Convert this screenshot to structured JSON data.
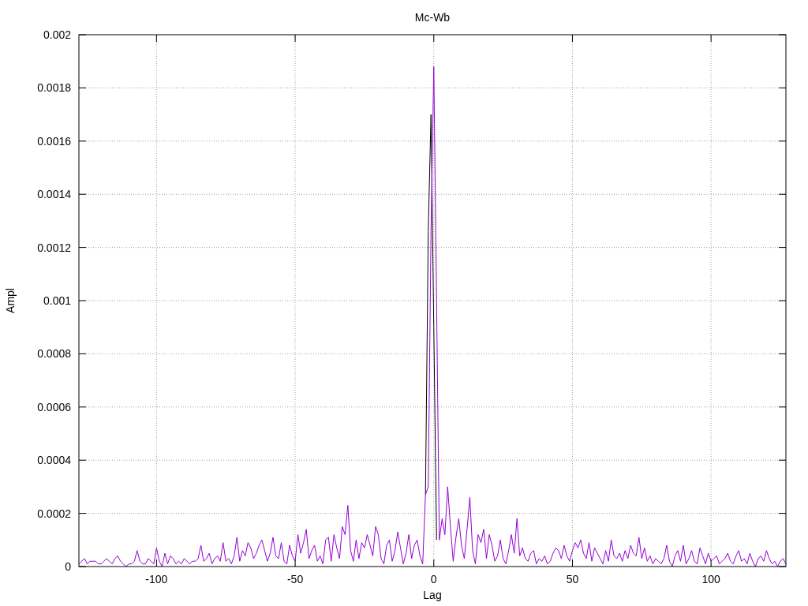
{
  "chart": {
    "chart_data": {
      "type": "line",
      "title": "Mc-Wb",
      "xlabel": "Lag",
      "ylabel": "Ampl",
      "xlim": [
        -128,
        127
      ],
      "ylim": [
        0,
        0.002
      ],
      "grid": true,
      "xticks": [
        -100,
        -50,
        0,
        50,
        100
      ],
      "yticks": [
        0,
        0.0002,
        0.0004,
        0.0006,
        0.0008,
        0.001,
        0.0012,
        0.0014,
        0.0016,
        0.0018,
        0.002
      ],
      "x": [
        -128,
        -127,
        -126,
        -125,
        -124,
        -123,
        -122,
        -121,
        -120,
        -119,
        -118,
        -117,
        -116,
        -115,
        -114,
        -113,
        -112,
        -111,
        -110,
        -109,
        -108,
        -107,
        -106,
        -105,
        -104,
        -103,
        -102,
        -101,
        -100,
        -99,
        -98,
        -97,
        -96,
        -95,
        -94,
        -93,
        -92,
        -91,
        -90,
        -89,
        -88,
        -87,
        -86,
        -85,
        -84,
        -83,
        -82,
        -81,
        -80,
        -79,
        -78,
        -77,
        -76,
        -75,
        -74,
        -73,
        -72,
        -71,
        -70,
        -69,
        -68,
        -67,
        -66,
        -65,
        -64,
        -63,
        -62,
        -61,
        -60,
        -59,
        -58,
        -57,
        -56,
        -55,
        -54,
        -53,
        -52,
        -51,
        -50,
        -49,
        -48,
        -47,
        -46,
        -45,
        -44,
        -43,
        -42,
        -41,
        -40,
        -39,
        -38,
        -37,
        -36,
        -35,
        -34,
        -33,
        -32,
        -31,
        -30,
        -29,
        -28,
        -27,
        -26,
        -25,
        -24,
        -23,
        -22,
        -21,
        -20,
        -19,
        -18,
        -17,
        -16,
        -15,
        -14,
        -13,
        -12,
        -11,
        -10,
        -9,
        -8,
        -7,
        -6,
        -5,
        -4,
        -3,
        -2,
        -1,
        0,
        1,
        2,
        3,
        4,
        5,
        6,
        7,
        8,
        9,
        10,
        11,
        12,
        13,
        14,
        15,
        16,
        17,
        18,
        19,
        20,
        21,
        22,
        23,
        24,
        25,
        26,
        27,
        28,
        29,
        30,
        31,
        32,
        33,
        34,
        35,
        36,
        37,
        38,
        39,
        40,
        41,
        42,
        43,
        44,
        45,
        46,
        47,
        48,
        49,
        50,
        51,
        52,
        53,
        54,
        55,
        56,
        57,
        58,
        59,
        60,
        61,
        62,
        63,
        64,
        65,
        66,
        67,
        68,
        69,
        70,
        71,
        72,
        73,
        74,
        75,
        76,
        77,
        78,
        79,
        80,
        81,
        82,
        83,
        84,
        85,
        86,
        87,
        88,
        89,
        90,
        91,
        92,
        93,
        94,
        95,
        96,
        97,
        98,
        99,
        100,
        101,
        102,
        103,
        104,
        105,
        106,
        107,
        108,
        109,
        110,
        111,
        112,
        113,
        114,
        115,
        116,
        117,
        118,
        119,
        120,
        121,
        122,
        123,
        124,
        125,
        126,
        127
      ],
      "series": [
        {
          "color": "#000000",
          "values": [
            null,
            null,
            null,
            null,
            null,
            null,
            null,
            null,
            null,
            null,
            null,
            null,
            null,
            null,
            null,
            null,
            null,
            null,
            null,
            null,
            null,
            null,
            null,
            null,
            null,
            null,
            null,
            null,
            null,
            null,
            null,
            null,
            null,
            null,
            null,
            null,
            null,
            null,
            null,
            null,
            null,
            null,
            null,
            null,
            null,
            null,
            null,
            null,
            null,
            null,
            null,
            null,
            null,
            null,
            null,
            null,
            null,
            null,
            null,
            null,
            null,
            null,
            null,
            null,
            null,
            null,
            null,
            null,
            null,
            null,
            null,
            null,
            null,
            null,
            null,
            null,
            null,
            null,
            null,
            null,
            null,
            null,
            null,
            null,
            null,
            null,
            null,
            null,
            null,
            null,
            null,
            null,
            null,
            null,
            null,
            null,
            null,
            null,
            null,
            null,
            null,
            null,
            null,
            null,
            null,
            null,
            null,
            null,
            null,
            null,
            null,
            null,
            null,
            null,
            null,
            null,
            null,
            null,
            null,
            null,
            null,
            null,
            null,
            null,
            null,
            0.00027,
            0.00126,
            0.0017,
            0.0009,
            0.0001,
            null,
            null,
            null,
            null,
            null,
            null,
            null,
            null,
            null,
            null,
            null,
            null,
            null,
            null,
            null,
            null,
            null,
            null,
            null,
            null,
            null,
            null,
            null,
            null,
            null,
            null,
            null,
            null,
            null,
            null,
            null,
            null,
            null,
            null,
            null,
            null,
            null,
            null,
            null,
            null,
            null,
            null,
            null,
            null,
            null,
            null,
            null,
            null,
            null,
            null,
            null,
            null,
            null,
            null,
            null,
            null,
            null,
            null,
            null,
            null,
            null,
            null,
            null,
            null,
            null,
            null,
            null,
            null,
            null,
            null,
            null,
            null,
            null,
            null,
            null,
            null,
            null,
            null,
            null,
            null,
            null,
            null,
            null,
            null,
            null,
            null,
            null,
            null,
            null,
            null,
            null,
            null,
            null,
            null,
            null,
            null,
            null,
            null,
            null,
            null,
            null,
            null,
            null,
            null,
            null,
            null,
            null,
            null,
            null,
            null,
            null,
            null,
            null,
            null,
            null,
            null,
            null,
            null,
            null,
            null,
            null,
            null,
            null,
            null,
            null,
            null
          ]
        },
        {
          "color": "#9400d3",
          "values": [
            1e-05,
            2e-05,
            3e-05,
            1e-05,
            2e-05,
            2e-05,
            2e-05,
            1e-05,
            1e-05,
            2e-05,
            3e-05,
            2e-05,
            1e-05,
            3e-05,
            4e-05,
            2e-05,
            1e-05,
            0,
            1e-05,
            1e-05,
            2e-05,
            6e-05,
            2e-05,
            1e-05,
            1e-05,
            3e-05,
            2e-05,
            1e-05,
            7e-05,
            2e-05,
            0,
            5e-05,
            1e-05,
            4e-05,
            3e-05,
            1e-05,
            2e-05,
            1e-05,
            3e-05,
            2e-05,
            1e-05,
            2e-05,
            2e-05,
            3e-05,
            8e-05,
            2e-05,
            3e-05,
            5e-05,
            1e-05,
            3e-05,
            4e-05,
            2e-05,
            9e-05,
            2e-05,
            3e-05,
            1e-05,
            4e-05,
            0.00011,
            2e-05,
            6e-05,
            4e-05,
            9e-05,
            7e-05,
            3e-05,
            5e-05,
            8e-05,
            0.0001,
            6e-05,
            2e-05,
            5e-05,
            0.00011,
            4e-05,
            3e-05,
            9e-05,
            2e-05,
            1e-05,
            8e-05,
            4e-05,
            2e-05,
            0.00012,
            5e-05,
            9e-05,
            0.00014,
            3e-05,
            6e-05,
            8e-05,
            2e-05,
            4e-05,
            1e-05,
            0.0001,
            0.00011,
            2e-05,
            0.00012,
            7e-05,
            3e-05,
            0.00015,
            0.00012,
            0.00023,
            6e-05,
            2e-05,
            0.0001,
            3e-05,
            9e-05,
            7e-05,
            0.00012,
            8e-05,
            4e-05,
            0.00015,
            0.00012,
            3e-05,
            1e-05,
            8e-05,
            0.0001,
            2e-05,
            6e-05,
            0.00013,
            7e-05,
            1e-05,
            5e-05,
            0.00012,
            3e-05,
            8e-05,
            0.0001,
            4e-05,
            1e-05,
            0.00027,
            0.0003,
            0.00126,
            0.00188,
            0.001,
            0.0001,
            0.00018,
            0.00012,
            0.0003,
            0.00015,
            2e-05,
            0.00011,
            0.00018,
            8e-05,
            3e-05,
            0.00014,
            0.00026,
            6e-05,
            1e-05,
            0.00012,
            9e-05,
            0.00014,
            3e-05,
            0.00012,
            8e-05,
            2e-05,
            4e-05,
            0.0001,
            3e-05,
            1e-05,
            6e-05,
            0.00012,
            5e-05,
            0.00018,
            4e-05,
            7e-05,
            3e-05,
            2e-05,
            5e-05,
            6e-05,
            1e-05,
            3e-05,
            2e-05,
            4e-05,
            1e-05,
            2e-05,
            5e-05,
            7e-05,
            6e-05,
            3e-05,
            8e-05,
            4e-05,
            2e-05,
            6e-05,
            9e-05,
            7e-05,
            0.0001,
            5e-05,
            3e-05,
            9e-05,
            2e-05,
            7e-05,
            5e-05,
            3e-05,
            1e-05,
            6e-05,
            2e-05,
            0.0001,
            4e-05,
            3e-05,
            5e-05,
            2e-05,
            6e-05,
            3e-05,
            8e-05,
            5e-05,
            4e-05,
            0.00011,
            3e-05,
            7e-05,
            2e-05,
            4e-05,
            1e-05,
            3e-05,
            2e-05,
            1e-05,
            3e-05,
            8e-05,
            2e-05,
            0,
            4e-05,
            6e-05,
            2e-05,
            8e-05,
            1e-05,
            3e-05,
            6e-05,
            2e-05,
            1e-05,
            7e-05,
            4e-05,
            1e-05,
            5e-05,
            2e-05,
            3e-05,
            4e-05,
            1e-05,
            2e-05,
            3e-05,
            5e-05,
            2e-05,
            1e-05,
            4e-05,
            6e-05,
            2e-05,
            3e-05,
            1e-05,
            5e-05,
            2e-05,
            0,
            3e-05,
            4e-05,
            2e-05,
            6e-05,
            3e-05,
            1e-05,
            2e-05,
            0,
            2e-05,
            3e-05,
            1e-05
          ]
        }
      ]
    }
  }
}
